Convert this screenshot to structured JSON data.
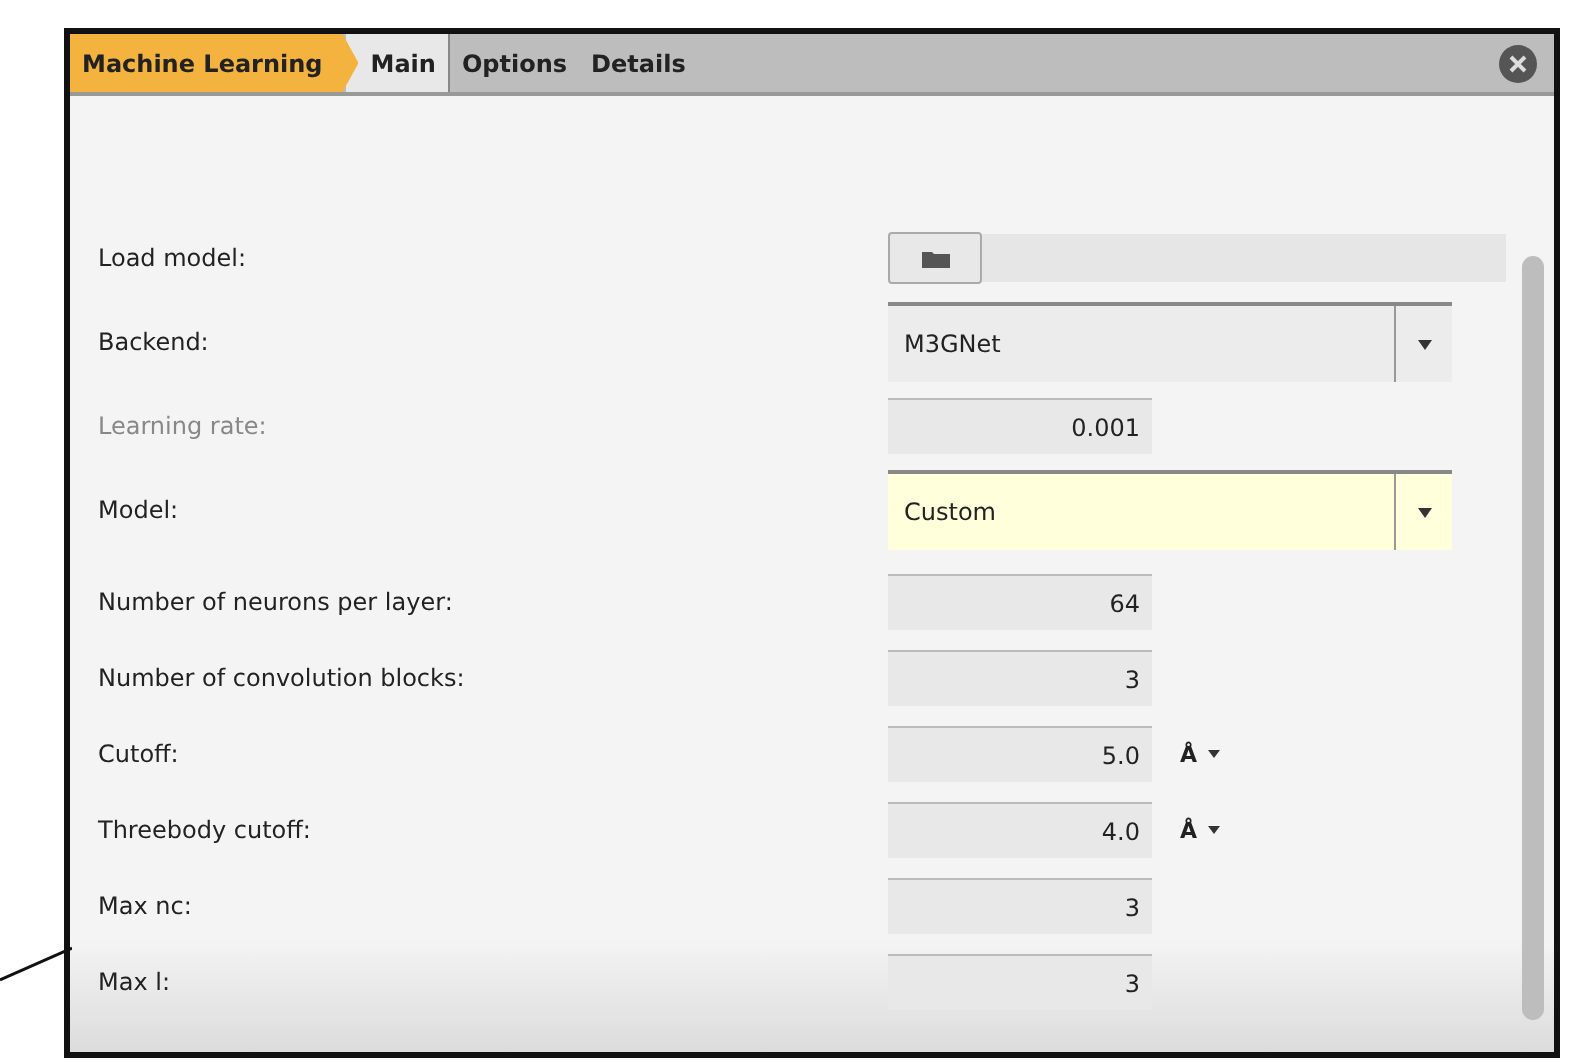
{
  "header": {
    "title": "Machine Learning"
  },
  "tabs": [
    {
      "label": "Main",
      "selected": true
    },
    {
      "label": "Options",
      "selected": false
    },
    {
      "label": "Details",
      "selected": false
    }
  ],
  "rows": [
    {
      "kind": "file",
      "label": "Load model:",
      "disabled": false
    },
    {
      "kind": "dropdown",
      "label": "Backend:",
      "value": "M3GNet",
      "highlighted": false,
      "disabled": false
    },
    {
      "kind": "number",
      "label": "Learning rate:",
      "value": "0.001",
      "disabled": true
    },
    {
      "kind": "dropdown",
      "label": "Model:",
      "value": "Custom",
      "highlighted": true,
      "disabled": false
    },
    {
      "kind": "number",
      "label": "Number of neurons per layer:",
      "value": "64",
      "disabled": false
    },
    {
      "kind": "number",
      "label": "Number of convolution blocks:",
      "value": "3",
      "disabled": false
    },
    {
      "kind": "number",
      "label": "Cutoff:",
      "value": "5.0",
      "unit": "Å",
      "disabled": false
    },
    {
      "kind": "number",
      "label": "Threebody cutoff:",
      "value": "4.0",
      "unit": "Å",
      "disabled": false
    },
    {
      "kind": "number",
      "label": "Max nc:",
      "value": "3",
      "disabled": false
    },
    {
      "kind": "number",
      "label": "Max l:",
      "value": "3",
      "disabled": false
    }
  ]
}
